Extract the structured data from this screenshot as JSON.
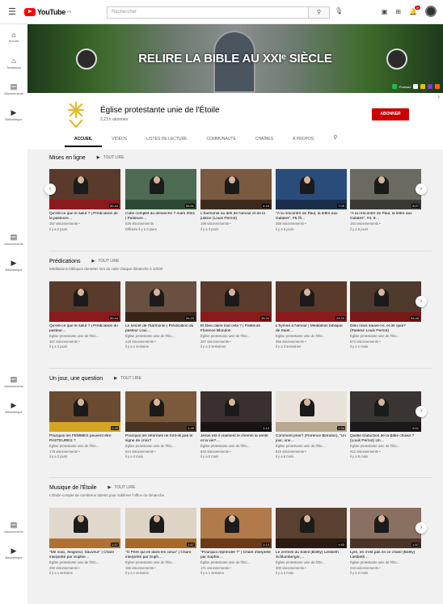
{
  "topbar": {
    "logo_text": "YouTube",
    "country_code": "FR",
    "search_placeholder": "Rechercher"
  },
  "sidebar": {
    "items": [
      {
        "label": "Accueil",
        "icon": "home-icon"
      },
      {
        "label": "Tendances",
        "icon": "trending-icon"
      },
      {
        "label": "Abonnements",
        "icon": "subscriptions-icon"
      },
      {
        "label": "Bibliothèque",
        "icon": "library-icon"
      }
    ]
  },
  "banner": {
    "title": "RELIRE LA BIBLE AU XXIᵉ SIÈCLE",
    "link_label": "Podcast"
  },
  "channel": {
    "name": "Église protestante unie de l'Étoile",
    "subscribers": "2,23 k abonnés",
    "subscribe_label": "ABONNER",
    "brand_color": "#e8b923",
    "tabs": [
      "ACCUEIL",
      "VIDÉOS",
      "LISTES DE LECTURE",
      "COMMUNAUTÉ",
      "CHAÎNES",
      "À PROPOS"
    ]
  },
  "play_all_label": "TOUT LIRE",
  "sections": [
    {
      "title": "Mises en ligne",
      "description": "",
      "videos": [
        {
          "title": "Qu'est-ce que le salut ? | Prédication de la pasteure…",
          "line2": "157 visionnements •",
          "line3": "il y a 2 jours",
          "duration": "30:44",
          "bg": "#5a3a2a",
          "accent": "#8b1a1a"
        },
        {
          "title": "Culte complet du dimanche 7 mars 2021 | Pasteure…",
          "line2": "526 visionnements",
          "line3": "Diffusée il y a 3 jours",
          "duration": "55:51",
          "bg": "#4d6b52",
          "accent": "#2e4a36"
        },
        {
          "title": "L'harmonie au défi de l'amour et de la justice (Louis Pernot)",
          "line2": "198 visionnements •",
          "line3": "il y a 3 jours",
          "duration": "4:19",
          "bg": "#7a5a40",
          "accent": "#3b2a1c"
        },
        {
          "title": "\"À la rencontre de Paul, la lettre aux Galates\", #5 l'll…",
          "line2": "359 visionnements •",
          "line3": "il y a 5 jours",
          "duration": "7:09",
          "bg": "#2a4c7a",
          "accent": "#1a2e4c"
        },
        {
          "title": "\"À la rencontre de Paul, la lettre aux Galates\", #4. 8…",
          "line2": "184 visionnements •",
          "line3": "il y a 6 jours",
          "duration": "8:27",
          "bg": "#6a6a60",
          "accent": "#3a3a34"
        }
      ]
    },
    {
      "title": "Prédications",
      "description": "Méditations bibliques données lors du culte chaque dimanche à 10h30",
      "videos": [
        {
          "title": "Qu'est-ce que le salut ? | Prédication du pasteur…",
          "line2": "Église protestante unie de l'Éto…",
          "line3": "157 visionnements •",
          "line4": "il y a 2 jours",
          "duration": "30:44",
          "bg": "#5a3a2a",
          "accent": "#8b1a1a"
        },
        {
          "title": "Le secret de l'harmonie | Prédication du pasteur Loui…",
          "line2": "Église protestante unie de l'Éto…",
          "line3": "218 visionnements •",
          "line4": "il y a 1 semaine",
          "duration": "34:23",
          "bg": "#6a5040",
          "accent": "#3a2418"
        },
        {
          "title": "Et Dieu dans tout cela ? | Pasteure Florence Blondon",
          "line2": "Église protestante unie de l'Éto…",
          "line3": "267 visionnements •",
          "line4": "il y a 2 semaines",
          "duration": "35:24",
          "bg": "#5c3c2c",
          "accent": "#8b1a1a"
        },
        {
          "title": "L'hymne à l'amour | Méditation biblique de Saint…",
          "line2": "Église protestante unie de l'Éto…",
          "line3": "356 visionnements •",
          "line4": "il y a 3 semaines",
          "duration": "24:24",
          "bg": "#5a3a2a",
          "accent": "#8b1a1a"
        },
        {
          "title": "Dieu nous sauve-t-il, et de quoi? (Pasteur Louis Pernot)",
          "line2": "Église protestante unie de l'Éto…",
          "line3": "874 visionnements •",
          "line4": "il y a 1 mois",
          "duration": "34:45",
          "bg": "#503a2e",
          "accent": "#7a1818"
        }
      ]
    },
    {
      "title": "Un jour, une question",
      "description": "",
      "videos": [
        {
          "title": "Pourquoi les FEMMES peuvent être PASTEURES ?",
          "line2": "Église protestante unie de l'Éto…",
          "line3": "178 visionnements •",
          "line4": "il y a 2 jours",
          "duration": "2:29",
          "bg": "#6a4a30",
          "accent": "#d4a520"
        },
        {
          "title": "Pourquoi les réformés ne font-ils pas le signe de croix?",
          "line2": "Église protestante unie de l'Éto…",
          "line3": "914 visionnements •",
          "line4": "il y a 4 mois",
          "duration": "1:49",
          "bg": "#7a5a3a",
          "accent": "#4a3420"
        },
        {
          "title": "Jésus est-il vraiment le chemin la vérité et la vie?…",
          "line2": "Église protestante unie de l'Éto…",
          "line3": "634 visionnements •",
          "line4": "il y a 6 mois",
          "duration": "1:13",
          "bg": "#3a3030",
          "accent": "#1a1414"
        },
        {
          "title": "Comment prier? (Florence Blondon), \"Un jour, une…",
          "line2": "Église protestante unie de l'Éto…",
          "line3": "815 visionnements •",
          "line4": "il y a 6 mois",
          "duration": "1:34",
          "bg": "#e8e2da",
          "accent": "#b8a890"
        },
        {
          "title": "Quelle traduction de la Bible choisir ? (Louis Pernot) Un…",
          "line2": "Église protestante unie de l'Éto…",
          "line3": "912 visionnements •",
          "line4": "il y a 5 mois",
          "duration": "6:21",
          "bg": "#3a3432",
          "accent": "#1a1818"
        }
      ]
    },
    {
      "title": "Musique de l'Étoile",
      "description": "L'Étoile compte de nombreux talents pour sublimer l'office du dimanche",
      "videos": [
        {
          "title": "\"Mé voici, Seigneur, Sauveur\" | Chant interprété par Sophie…",
          "line2": "Église protestante unie de l'Éto…",
          "line3": "260 visionnements •",
          "line4": "il y a 1 semaine",
          "duration": "1:57",
          "bg": "#e0d8cc",
          "accent": "#b07030"
        },
        {
          "title": "\"Ô Père qui es dans les cieux\" | Chant interprété par Soph…",
          "line2": "Église protestante unie de l'Éto…",
          "line3": "165 visionnements •",
          "line4": "il y a 1 semaine",
          "duration": "1:57",
          "bg": "#ddd4c6",
          "accent": "#a86828"
        },
        {
          "title": "\"Pourquoi reprendre ?\" | Chant interprété par Sophie…",
          "line2": "Église protestante unie de l'Éto…",
          "line3": "171 visionnements •",
          "line4": "il y a 1 semaine",
          "duration": "2:14",
          "bg": "#b07a4a",
          "accent": "#6a3a1a"
        },
        {
          "title": "Le vermeil du Soleil (Boëly) Liesbeth Schlumberger,…",
          "line2": "Église protestante unie de l'Éto…",
          "line3": "300 visionnements •",
          "line4": "il y a 2 mois",
          "duration": "1:53",
          "bg": "#5a4030",
          "accent": "#2a1a12"
        },
        {
          "title": "Lyre, en n'est pas en ce chant (Boëly) Liesbeth…",
          "line2": "Église protestante unie de l'Éto…",
          "line3": "244 visionnements •",
          "line4": "il y a 2 mois",
          "duration": "1:57",
          "bg": "#8a7060",
          "accent": "#4a3428"
        }
      ]
    }
  ]
}
